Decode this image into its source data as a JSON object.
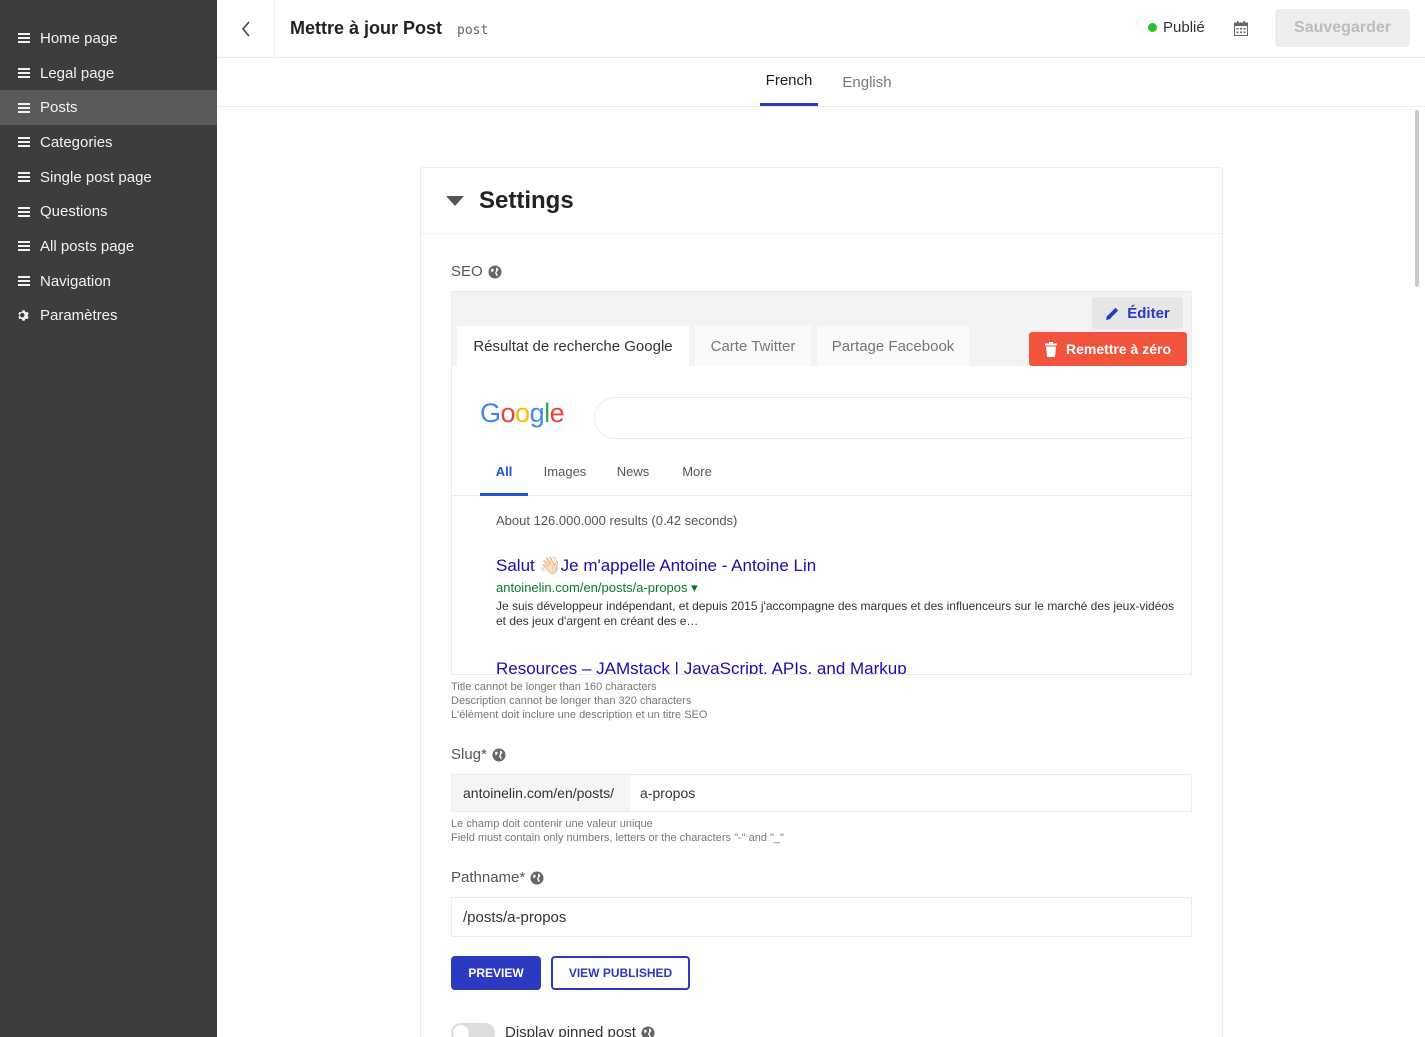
{
  "sidebar": {
    "items": [
      {
        "label": "Home page",
        "icon": "list-icon"
      },
      {
        "label": "Legal page",
        "icon": "list-icon"
      },
      {
        "label": "Posts",
        "icon": "list-icon",
        "active": true
      },
      {
        "label": "Categories",
        "icon": "list-icon"
      },
      {
        "label": "Single post page",
        "icon": "list-icon"
      },
      {
        "label": "Questions",
        "icon": "list-icon"
      },
      {
        "label": "All posts page",
        "icon": "list-icon"
      },
      {
        "label": "Navigation",
        "icon": "list-icon"
      },
      {
        "label": "Paramètres",
        "icon": "gear-icon"
      }
    ]
  },
  "header": {
    "title": "Mettre à jour Post",
    "type": "post",
    "status": "Publié",
    "status_color": "#27c227",
    "save_label": "Sauvegarder"
  },
  "lang_tabs": [
    {
      "label": "French",
      "active": true
    },
    {
      "label": "English",
      "active": false
    }
  ],
  "settings": {
    "title": "Settings",
    "seo": {
      "label": "SEO",
      "tabs": [
        "Résultat de recherche Google",
        "Carte Twitter",
        "Partage Facebook"
      ],
      "edit_label": "Éditer",
      "reset_label": "Remettre à zéro",
      "google": {
        "logo": "Google",
        "tabs": [
          "All",
          "Images",
          "News",
          "More"
        ],
        "stats": "About 126.000.000 results (0.42 seconds)",
        "result_title": "Salut 👋🏻Je m'appelle Antoine - Antoine Lin",
        "result_url": "antoinelin.com/en/posts/a-propos ▾",
        "result_desc": "Je suis développeur indépendant, et depuis 2015 j'accompagne des marques et des influenceurs sur le marché des jeux-vidéos et des jeux d'argent en créant des e…",
        "result2_title": "Resources – JAMstack | JavaScript, APIs, and Markup"
      },
      "hints": [
        "Title cannot be longer than 160 characters",
        "Description cannot be longer than 320 characters",
        "L'élément doit inclure une description et un titre SEO"
      ]
    },
    "slug": {
      "label": "Slug*",
      "prefix": "antoinelin.com/en/posts/",
      "value": "a-propos",
      "hints": [
        "Le champ doit contenir une valeur unique",
        "Field must contain only numbers, letters or the characters \"-\" and \"_\""
      ]
    },
    "pathname": {
      "label": "Pathname*",
      "value": "/posts/a-propos"
    },
    "preview_label": "PREVIEW",
    "view_published_label": "VIEW PUBLISHED",
    "pinned_label": "Display pinned post"
  },
  "colors": {
    "accent": "#2b3ac0",
    "danger": "#f1533c",
    "sidebar_bg": "#3d3d3d"
  }
}
